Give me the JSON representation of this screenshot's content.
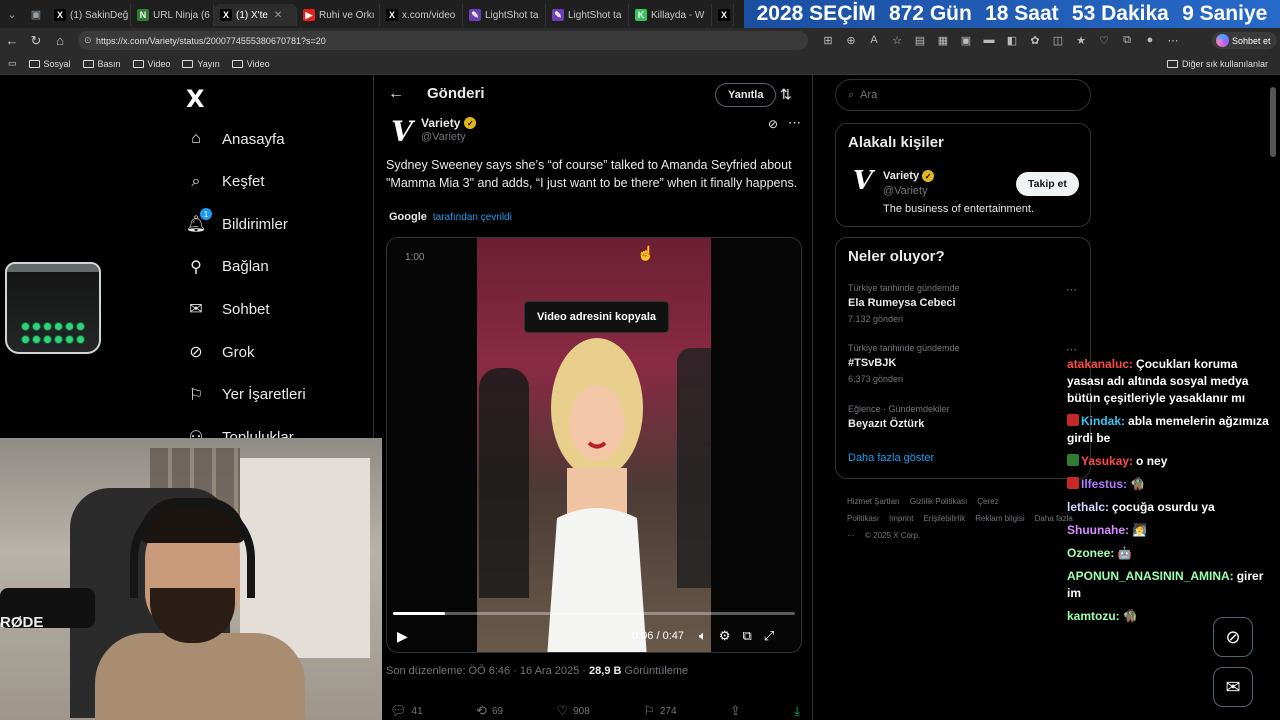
{
  "browser": {
    "tabs": [
      {
        "label": "(1) SakinDeğ",
        "fav": "X",
        "favcolor": "#000000"
      },
      {
        "label": "URL Ninja (6",
        "fav": "N",
        "favcolor": "#2e7d32"
      },
      {
        "label": "(1) X'te",
        "fav": "X",
        "favcolor": "#000000"
      },
      {
        "label": "Ruhi ve Orkı",
        "fav": "▶",
        "favcolor": "#e62117"
      },
      {
        "label": "x.com/video",
        "fav": "X",
        "favcolor": "#000000"
      },
      {
        "label": "LightShot ta",
        "fav": "✎",
        "favcolor": "#6b3fb8"
      },
      {
        "label": "LightShot ta",
        "fav": "✎",
        "favcolor": "#6b3fb8"
      },
      {
        "label": "Killayda - W",
        "fav": "K",
        "favcolor": "#35c45a"
      },
      {
        "label": "X",
        "fav": "X",
        "favcolor": "#000000"
      }
    ],
    "countdown": {
      "year_label": "2028 SEÇİM",
      "days": "872 Gün",
      "hours": "18 Saat",
      "minutes": "53 Dakika",
      "seconds": "9 Saniye"
    },
    "url": "https://x.com/Variety/status/2000774555380670781?s=20",
    "copilot_label": "Sohbet et",
    "bookmarks": [
      "Sosyal",
      "Basın",
      "Video",
      "Yayın",
      "Video"
    ],
    "other_bookmarks": "Diğer sık kullanılanlar"
  },
  "nav": {
    "logo": "X",
    "items": [
      {
        "label": "Anasayfa",
        "icon": "home-icon"
      },
      {
        "label": "Keşfet",
        "icon": "search-icon"
      },
      {
        "label": "Bildirimler",
        "icon": "bell-icon",
        "badge": "1"
      },
      {
        "label": "Bağlan",
        "icon": "person-add-icon"
      },
      {
        "label": "Sohbet",
        "icon": "mail-icon"
      },
      {
        "label": "Grok",
        "icon": "grok-icon"
      },
      {
        "label": "Yer İşaretleri",
        "icon": "bookmark-icon"
      },
      {
        "label": "Topluluklar",
        "icon": "communities-icon"
      }
    ]
  },
  "post": {
    "header_title": "Gönderi",
    "reply_button": "Yanıtla",
    "author_name": "Variety",
    "author_handle": "@Variety",
    "text": "Sydney Sweeney says she’s “of course” talked to Amanda Seyfried about \"Mamma Mia 3\" and adds, “I just want to be there” when it finally happens.",
    "translation_brand": "Google",
    "translation_link": "tarafından çevrildi",
    "video": {
      "top_time": "1:00",
      "copy_tooltip": "Video adresini kopyala",
      "time": "0:06 / 0:47",
      "progress": 0.13
    },
    "edited_label": "Son düzenleme: ÖÖ 6:46 · 16 Ara 2025 ·",
    "views_count": "28,9 B",
    "views_label": "Görüntüleme",
    "actions": {
      "replies": "41",
      "reposts": "69",
      "likes": "908",
      "bookmarks": "274"
    }
  },
  "right": {
    "search_placeholder": "Ara",
    "related_title": "Alakalı kişiler",
    "related_name": "Variety",
    "related_handle": "@Variety",
    "related_bio": "The business of entertainment.",
    "follow_label": "Takip et",
    "trends_title": "Neler oluyor?",
    "trends": [
      {
        "context": "Türkiye tarihinde gündemde",
        "name": "Ela Rumeysa Cebeci",
        "count": "7.132 gönderi"
      },
      {
        "context": "Türkiye tarihinde gündemde",
        "name": "#TSvBJK",
        "count": "6.373 gönderi"
      },
      {
        "context": "Eğlence · Gündemdekiler",
        "name": "Beyazıt Öztürk",
        "count": ""
      }
    ],
    "show_more": "Daha fazla göster",
    "footer": [
      "Hizmet Şartları",
      "Gizlilik Politikası",
      "Çerez Politikası",
      "Imprint",
      "Erişilebilirlik",
      "Reklam bilgisi",
      "Daha fazla ···",
      "© 2025 X Corp."
    ]
  },
  "chat": [
    {
      "user": "atakanaluc:",
      "color": "#ff4a4a",
      "text": "Çocukları koruma yasası adı altında sosyal medya bütün çeşitleriyle yasaklanır mı",
      "icon": ""
    },
    {
      "user": "Kindak:",
      "color": "#36c5f0",
      "text": "abla memelerin ağzımıza girdi be",
      "icon": "#c62828"
    },
    {
      "user": "Yasukay:",
      "color": "#ff4a4a",
      "text": "o ney",
      "icon": "#2e7d32"
    },
    {
      "user": "Ilfestus:",
      "color": "#b07bff",
      "text": "🧌",
      "icon": "#c62828"
    },
    {
      "user": "lethalc:",
      "color": "#cfd8ff",
      "text": "çocuğa osurdu ya",
      "icon": ""
    },
    {
      "user": "Shuunahe:",
      "color": "#d98cff",
      "text": "🧖",
      "icon": ""
    },
    {
      "user": "Ozonee:",
      "color": "#9dffb0",
      "text": "🤖",
      "icon": ""
    },
    {
      "user": "APONUN_ANASININ_AMINA:",
      "color": "#9dffb0",
      "text": "girer im",
      "icon": ""
    },
    {
      "user": "kamtozu:",
      "color": "#9dffb0",
      "text": "🧌",
      "icon": ""
    }
  ],
  "webcam": {
    "mic_brand": "RØDE"
  }
}
